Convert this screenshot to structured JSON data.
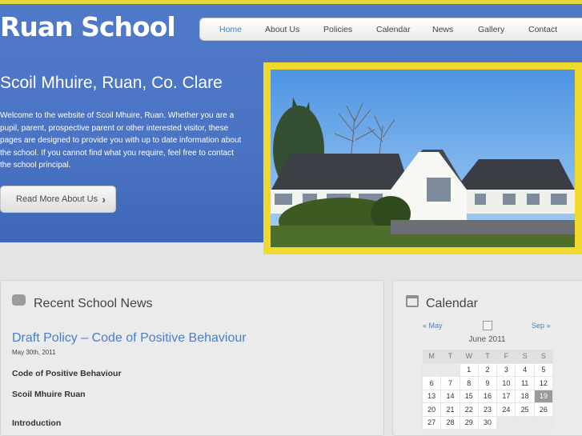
{
  "site": {
    "title": "Ruan School"
  },
  "nav": [
    {
      "label": "Home",
      "active": true
    },
    {
      "label": "About Us"
    },
    {
      "label": "Policies"
    },
    {
      "label": "Calendar"
    },
    {
      "label": "News"
    },
    {
      "label": "Gallery"
    },
    {
      "label": "Contact"
    }
  ],
  "hero": {
    "tagline": "Scoil Mhuire, Ruan, Co. Clare",
    "intro": "Welcome to the website of Scoil Mhuire, Ruan. Whether you are a pupil, parent, prospective parent or other interested visitor, these pages are designed to provide you with up to date information about the school. If you cannot find what you require, feel free to contact the school principal.",
    "button_label": "Read More About Us",
    "button_icon": "chevron-right-icon"
  },
  "news": {
    "heading": "Recent School News",
    "icon": "speech-bubble-icon",
    "post_title": "Draft Policy – Code of Positive Behaviour",
    "post_date": "May 30th, 2011",
    "lines": [
      "Code of Positive Behaviour",
      "Scoil Mhuire Ruan",
      "Introduction"
    ]
  },
  "calendar": {
    "heading": "Calendar",
    "icon": "calendar-icon",
    "prev": "« May",
    "next": "Sep »",
    "feed_icon": "rss-feed-icon",
    "month": "June 2011",
    "weekdays": [
      "M",
      "T",
      "W",
      "T",
      "F",
      "S",
      "S"
    ],
    "weeks": [
      [
        "",
        "",
        "1",
        "2",
        "3",
        "4",
        "5"
      ],
      [
        "6",
        "7",
        "8",
        "9",
        "10",
        "11",
        "12"
      ],
      [
        "13",
        "14",
        "15",
        "16",
        "17",
        "18",
        "19"
      ],
      [
        "20",
        "21",
        "22",
        "23",
        "24",
        "25",
        "26"
      ],
      [
        "27",
        "28",
        "29",
        "30",
        "",
        "",
        ""
      ]
    ],
    "today": "19"
  },
  "colors": {
    "hero_blue": "#4a73c4",
    "accent_yellow": "#e8d63a",
    "link_blue": "#4b7dc8"
  }
}
